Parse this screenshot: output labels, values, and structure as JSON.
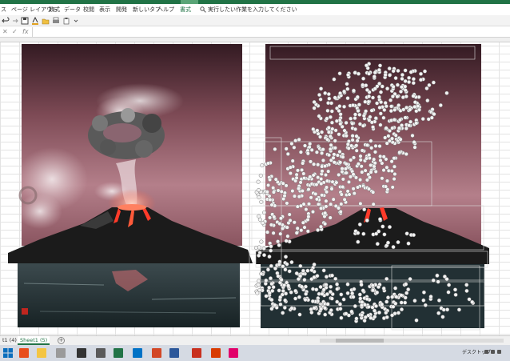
{
  "ribbon": {
    "tabs": [
      "ス",
      "ページ レイアウト",
      "数式",
      "データ",
      "校閲",
      "表示",
      "開発",
      "新しいタブ",
      "ヘルプ",
      "書式"
    ],
    "search_text": "実行したい作業を入力してください"
  },
  "formula_bar": {
    "fx_label": "fx",
    "value": ""
  },
  "sheet_tabs": {
    "prev_tab": "t1 (4)",
    "active_tab": "Sheet1 (5)",
    "add_label": "+"
  },
  "taskbar": {
    "desktop_label": "デスクトップ"
  },
  "artwork": {
    "left_title": "",
    "right_title": ""
  },
  "colors": {
    "excel_green": "#217346",
    "sky_dark": "#3a1e28",
    "sky_light": "#b47f8a",
    "lava": "#ff3b2a",
    "mountain": "#1b1b1b",
    "water": "#223034"
  },
  "icons": [
    "search-icon",
    "undo-icon",
    "redo-icon",
    "save-icon",
    "open-icon",
    "print-icon",
    "fx-icon",
    "windows-start-icon",
    "excel-icon",
    "outlook-icon",
    "powerpoint-icon",
    "word-icon",
    "browser-icon"
  ]
}
